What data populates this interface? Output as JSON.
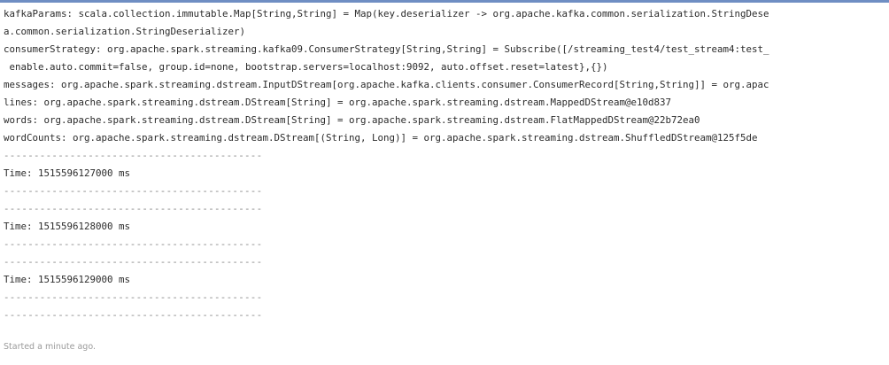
{
  "output": {
    "lines": [
      "kafkaParams: scala.collection.immutable.Map[String,String] = Map(key.deserializer -> org.apache.kafka.common.serialization.StringDese",
      "a.common.serialization.StringDeserializer)",
      "consumerStrategy: org.apache.spark.streaming.kafka09.ConsumerStrategy[String,String] = Subscribe([/streaming_test4/test_stream4:test_",
      " enable.auto.commit=false, group.id=none, bootstrap.servers=localhost:9092, auto.offset.reset=latest},{})",
      "messages: org.apache.spark.streaming.dstream.InputDStream[org.apache.kafka.clients.consumer.ConsumerRecord[String,String]] = org.apac",
      "lines: org.apache.spark.streaming.dstream.DStream[String] = org.apache.spark.streaming.dstream.MappedDStream@e10d837",
      "words: org.apache.spark.streaming.dstream.DStream[String] = org.apache.spark.streaming.dstream.FlatMappedDStream@22b72ea0",
      "wordCounts: org.apache.spark.streaming.dstream.DStream[(String, Long)] = org.apache.spark.streaming.dstream.ShuffledDStream@125f5de",
      "-------------------------------------------",
      "Time: 1515596127000 ms",
      "-------------------------------------------",
      "-------------------------------------------",
      "Time: 1515596128000 ms",
      "-------------------------------------------",
      "-------------------------------------------",
      "Time: 1515596129000 ms",
      "-------------------------------------------",
      "-------------------------------------------"
    ]
  },
  "status": {
    "text": "Started a minute ago."
  },
  "colors": {
    "top_bar": "#6f8ec3",
    "text": "#2b2b2b",
    "status_text": "#9a9a9a"
  }
}
